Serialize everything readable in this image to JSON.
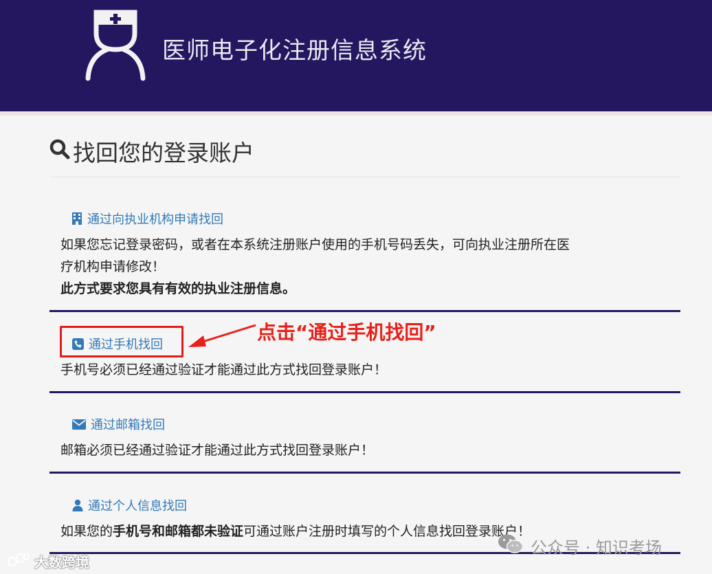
{
  "header": {
    "site_title": "医师电子化注册信息系统"
  },
  "page": {
    "title": "找回您的登录账户"
  },
  "options": [
    {
      "link": "通过向执业机构申请找回",
      "icon": "building-icon",
      "desc_line1": "如果您忘记登录密码，或者在本系统注册账户使用的手机号码丢失，可向执业注册所在医",
      "desc_line2": "疗机构申请修改！",
      "desc_bold": "此方式要求您具有有效的执业注册信息。"
    },
    {
      "link": "通过手机找回",
      "icon": "phone-icon",
      "desc": "手机号必须已经通过验证才能通过此方式找回登录账户！"
    },
    {
      "link": "通过邮箱找回",
      "icon": "envelope-icon",
      "desc": "邮箱必须已经通过验证才能通过此方式找回登录账户！"
    },
    {
      "link": "通过个人信息找回",
      "icon": "user-icon",
      "desc_pre": "如果您的",
      "desc_bold": "手机号和邮箱都未验证",
      "desc_post": "可通过账户注册时填写的个人信息找回登录账户！"
    }
  ],
  "annotation": {
    "text": "点击“通过手机找回”"
  },
  "watermarks": {
    "left": "大数跨境",
    "right": "公众号 · 知识考场"
  },
  "colors": {
    "header_bg": "#241760",
    "link": "#337ab7",
    "annotation": "#e8201a"
  }
}
